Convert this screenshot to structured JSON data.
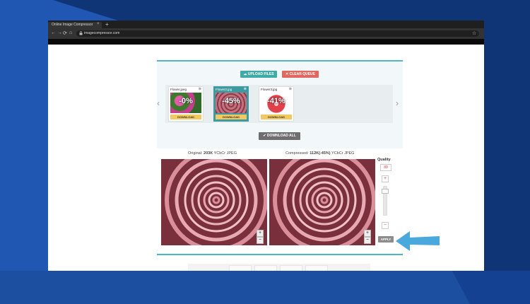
{
  "browser": {
    "tab_title": "Online Image Compressor",
    "tab_close": "×",
    "new_tab": "+",
    "url": "imagecompressor.com",
    "nav": {
      "back": "←",
      "forward": "→",
      "reload": "⟳",
      "home": "⌂",
      "lock": "🔒",
      "star": "☆"
    }
  },
  "toolbar": {
    "upload_label": "UPLOAD FILES",
    "clear_label": "CLEAR QUEUE",
    "download_all_label": "DOWNLOAD ALL",
    "upload_icon": "upload-icon",
    "clear_icon": "close-icon",
    "download_icon": "check-icon"
  },
  "queue": {
    "prev_arrow": "‹",
    "next_arrow": "›",
    "files": [
      {
        "name": "Flower.jpeg",
        "percent": "-0%",
        "download": "DOWNLOAD",
        "active": false
      },
      {
        "name": "Flower2.jpg",
        "percent": "-45%",
        "download": "DOWNLOAD",
        "active": true
      },
      {
        "name": "Flower3.jpg",
        "percent": "-41%",
        "download": "DOWNLOAD",
        "active": false
      }
    ]
  },
  "compare": {
    "original_prefix": "Original: ",
    "original_size": "203K",
    "original_suffix": " YCbCr JPEG",
    "compressed_prefix": "Compressed: ",
    "compressed_size": "112K(-45%)",
    "compressed_suffix": " YCbCr JPEG",
    "zoom_in": "+",
    "zoom_out": "−"
  },
  "quality": {
    "label": "Quality",
    "value": "89",
    "plus": "+",
    "minus": "−",
    "level": 0.89,
    "apply_label": "APPLY"
  },
  "colors": {
    "accent_teal": "#3faaa7",
    "clear_red": "#e0685e",
    "pointer_blue": "#4aa9dc"
  }
}
